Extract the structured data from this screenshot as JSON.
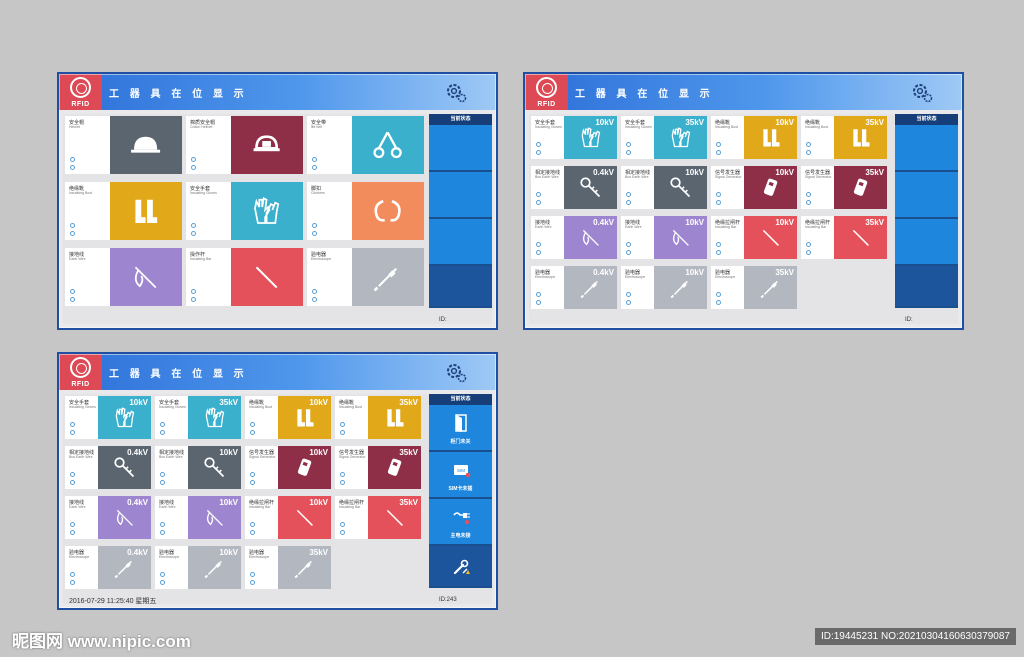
{
  "colors": {
    "blue": "#3ab0cc",
    "maroon": "#8e2f47",
    "cyan": "#3ab0cc",
    "yellow": "#e1a81a",
    "orange": "#f38c5c",
    "purple": "#9d86cf",
    "red": "#e4515a",
    "gray": "#b3b8c0",
    "slate": "#5a6570",
    "sidebar": "#1e86dc"
  },
  "screens": [
    {
      "logo": "RFID",
      "title": "工 器 具 在 位 显 示",
      "status_header": "当前状态",
      "id_label": "ID:",
      "cards": [
        {
          "cn": "安全帽",
          "en": "Helmet",
          "color": "slate",
          "icon": "helmet-icon"
        },
        {
          "cn": "棉质安全帽",
          "en": "Cotton Helmet",
          "color": "maroon",
          "icon": "cotton-helmet-icon"
        },
        {
          "cn": "安全带",
          "en": "life belt",
          "color": "cyan",
          "icon": "safety-belt-icon"
        },
        {
          "cn": "绝缘靴",
          "en": "Insulating Boot",
          "color": "yellow",
          "icon": "boots-icon"
        },
        {
          "cn": "安全手套",
          "en": "Insulating Gloves",
          "color": "cyan",
          "icon": "gloves-icon"
        },
        {
          "cn": "脚扣",
          "en": "Climbers",
          "color": "orange",
          "icon": "climbers-icon"
        },
        {
          "cn": "接地线",
          "en": "Earth Wire",
          "color": "purple",
          "icon": "earth-wire-icon"
        },
        {
          "cn": "操作杆",
          "en": "Insulating Bar",
          "color": "red",
          "icon": "insulating-bar-icon"
        },
        {
          "cn": "验电器",
          "en": "Electroscope",
          "color": "gray",
          "icon": "electroscope-icon"
        }
      ]
    },
    {
      "logo": "RFID",
      "title": "工 器 具 在 位 显 示",
      "status_header": "当前状态",
      "id_label": "ID:",
      "cards": [
        {
          "cn": "安全手套",
          "en": "Insulating Gloves",
          "volt": "10kV",
          "color": "cyan",
          "icon": "gloves-icon"
        },
        {
          "cn": "安全手套",
          "en": "Insulating Gloves",
          "volt": "35kV",
          "color": "cyan",
          "icon": "gloves-icon"
        },
        {
          "cn": "绝缘靴",
          "en": "Insulating Boot",
          "volt": "10kV",
          "color": "yellow",
          "icon": "boots-icon"
        },
        {
          "cn": "绝缘靴",
          "en": "Insulating Boot",
          "volt": "35kV",
          "color": "yellow",
          "icon": "boots-icon"
        },
        {
          "cn": "相定接地线",
          "en": "Bus Earth Wire",
          "volt": "0.4kV",
          "color": "slate",
          "icon": "bus-earth-wire-icon"
        },
        {
          "cn": "相定接地线",
          "en": "Bus Earth Wire",
          "volt": "10kV",
          "color": "slate",
          "icon": "bus-earth-wire-icon"
        },
        {
          "cn": "信号发生器",
          "en": "Signal Generator",
          "volt": "10kV",
          "color": "maroon",
          "icon": "signal-generator-icon"
        },
        {
          "cn": "信号发生器",
          "en": "Signal Generator",
          "volt": "35kV",
          "color": "maroon",
          "icon": "signal-generator-icon"
        },
        {
          "cn": "接地线",
          "en": "Earth Wire",
          "volt": "0.4kV",
          "color": "purple",
          "icon": "earth-wire-icon"
        },
        {
          "cn": "接地线",
          "en": "Earth Wire",
          "volt": "10kV",
          "color": "purple",
          "icon": "earth-wire-icon"
        },
        {
          "cn": "绝缘拉闸杆",
          "en": "Insulating Bar",
          "volt": "10kV",
          "color": "red",
          "icon": "insulating-bar-icon"
        },
        {
          "cn": "绝缘拉闸杆",
          "en": "Insulating Bar",
          "volt": "35kV",
          "color": "red",
          "icon": "insulating-bar-icon"
        },
        {
          "cn": "验电器",
          "en": "Electroscope",
          "volt": "0.4kV",
          "color": "gray",
          "icon": "electroscope-icon"
        },
        {
          "cn": "验电器",
          "en": "Electroscope",
          "volt": "10kV",
          "color": "gray",
          "icon": "electroscope-icon"
        },
        {
          "cn": "验电器",
          "en": "Electroscope",
          "volt": "35kV",
          "color": "gray",
          "icon": "electroscope-icon"
        }
      ]
    },
    {
      "logo": "RFID",
      "title": "工 器 具 在 位 显 示",
      "status_header": "当前状态",
      "id_label": "ID:243",
      "datetime": "2016-07-29  11:25:40 星期五",
      "status_items": [
        {
          "label": "柜门未关",
          "icon": "door-icon"
        },
        {
          "label": "SIM卡未插",
          "icon": "sim-card-icon"
        },
        {
          "label": "主电未接",
          "icon": "power-plug-icon"
        },
        {
          "label": "",
          "icon": "wrench-icon"
        }
      ],
      "cards": [
        {
          "cn": "安全手套",
          "en": "Insulating Gloves",
          "volt": "10kV",
          "color": "cyan",
          "icon": "gloves-icon"
        },
        {
          "cn": "安全手套",
          "en": "Insulating Gloves",
          "volt": "35kV",
          "color": "cyan",
          "icon": "gloves-icon"
        },
        {
          "cn": "绝缘靴",
          "en": "Insulating Boot",
          "volt": "10kV",
          "color": "yellow",
          "icon": "boots-icon"
        },
        {
          "cn": "绝缘靴",
          "en": "Insulating Boot",
          "volt": "35kV",
          "color": "yellow",
          "icon": "boots-icon"
        },
        {
          "cn": "相定接地线",
          "en": "Bus Earth Wire",
          "volt": "0.4kV",
          "color": "slate",
          "icon": "bus-earth-wire-icon"
        },
        {
          "cn": "相定接地线",
          "en": "Bus Earth Wire",
          "volt": "10kV",
          "color": "slate",
          "icon": "bus-earth-wire-icon"
        },
        {
          "cn": "信号发生器",
          "en": "Signal Generator",
          "volt": "10kV",
          "color": "maroon",
          "icon": "signal-generator-icon"
        },
        {
          "cn": "信号发生器",
          "en": "Signal Generator",
          "volt": "35kV",
          "color": "maroon",
          "icon": "signal-generator-icon"
        },
        {
          "cn": "接地线",
          "en": "Earth Wire",
          "volt": "0.4kV",
          "color": "purple",
          "icon": "earth-wire-icon"
        },
        {
          "cn": "接地线",
          "en": "Earth Wire",
          "volt": "10kV",
          "color": "purple",
          "icon": "earth-wire-icon"
        },
        {
          "cn": "绝缘拉闸杆",
          "en": "Insulating Bar",
          "volt": "10kV",
          "color": "red",
          "icon": "insulating-bar-icon"
        },
        {
          "cn": "绝缘拉闸杆",
          "en": "Insulating Bar",
          "volt": "35kV",
          "color": "red",
          "icon": "insulating-bar-icon"
        },
        {
          "cn": "验电器",
          "en": "Electroscope",
          "volt": "0.4kV",
          "color": "gray",
          "icon": "electroscope-icon"
        },
        {
          "cn": "验电器",
          "en": "Electroscope",
          "volt": "10kV",
          "color": "gray",
          "icon": "electroscope-icon"
        },
        {
          "cn": "验电器",
          "en": "Electroscope",
          "volt": "35kV",
          "color": "gray",
          "icon": "electroscope-icon"
        }
      ]
    }
  ],
  "watermark": {
    "left": "昵图网 www.nipic.com",
    "right": "ID:19445231 NO:20210304160630379087"
  }
}
